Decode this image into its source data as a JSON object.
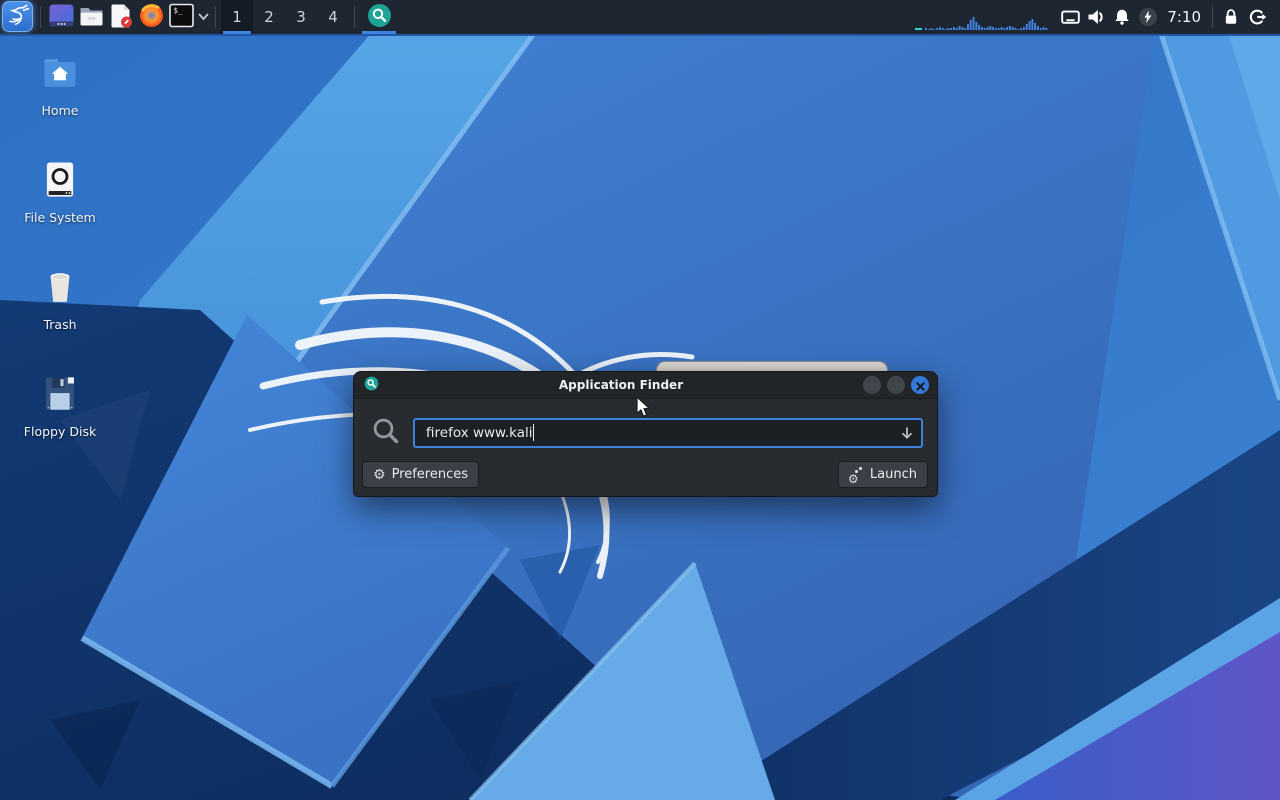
{
  "panel": {
    "launchers": [
      {
        "name": "kali-menu"
      },
      {
        "name": "dashboard"
      },
      {
        "name": "file-manager"
      },
      {
        "name": "text-editor"
      },
      {
        "name": "firefox"
      },
      {
        "name": "terminal"
      }
    ],
    "terminal_glyph": "$_",
    "workspaces": [
      "1",
      "2",
      "3",
      "4"
    ],
    "active_workspace": "1",
    "taskbar_app": "application-finder",
    "cpu_bars": [
      2,
      1,
      2,
      1,
      2,
      3,
      2,
      1,
      2,
      2,
      3,
      2,
      4,
      3,
      2,
      6,
      10,
      13,
      8,
      5,
      3,
      2,
      3,
      4,
      3,
      2,
      2,
      3,
      2,
      3,
      4,
      3,
      2,
      1,
      2,
      3,
      6,
      9,
      11,
      7,
      4,
      2,
      3,
      2
    ],
    "clock": "7:10"
  },
  "desktop": {
    "icons": [
      {
        "name": "home",
        "label": "Home"
      },
      {
        "name": "file-system",
        "label": "File System"
      },
      {
        "name": "trash",
        "label": "Trash"
      },
      {
        "name": "floppy-disk",
        "label": "Floppy Disk"
      }
    ]
  },
  "appfinder": {
    "title": "Application Finder",
    "search_value": "firefox www.kali",
    "buttons": {
      "preferences": "Preferences",
      "launch": "Launch"
    }
  },
  "icons": {
    "gear_glyph": "⚙"
  },
  "colors": {
    "accent": "#3e83e0",
    "panel_bg": "#1e2632",
    "panel_border": "#2456a8",
    "dialog_bg": "#282b30",
    "titlebar_bg": "#222528",
    "input_bg": "#1c1f23",
    "input_border": "#3f82da",
    "close_button": "#3478d8",
    "appfinder_teal": "#1ea396",
    "wallpaper_base": "#2f74c8",
    "wallpaper_dark": "#0e3166",
    "wallpaper_purple": "#5b54c6"
  }
}
